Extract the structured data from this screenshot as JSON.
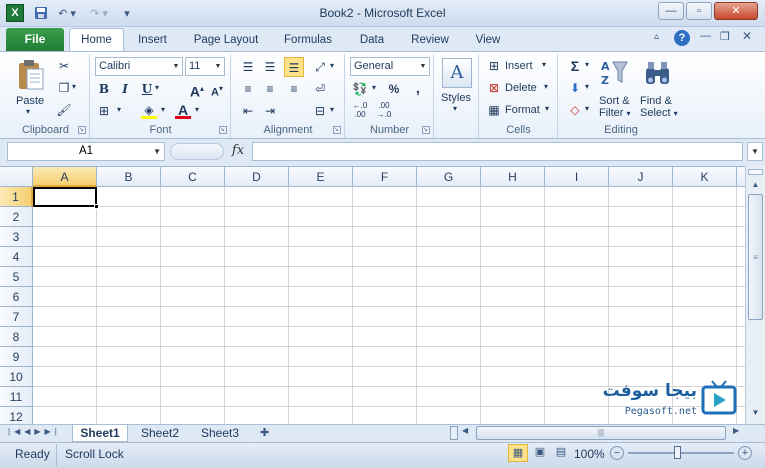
{
  "window": {
    "title": "Book2  -  Microsoft Excel",
    "app_icon": "X",
    "colors": {
      "file_tab": "#2a8c3f",
      "accent": "#1e395b",
      "active_cell_border": "#000000"
    }
  },
  "tabs": [
    "File",
    "Home",
    "Insert",
    "Page Layout",
    "Formulas",
    "Data",
    "Review",
    "View"
  ],
  "ribbon": {
    "clipboard": {
      "label": "Clipboard",
      "paste": "Paste"
    },
    "font": {
      "label": "Font",
      "font_name": "Calibri",
      "font_size": "11",
      "bold": "B",
      "italic": "I",
      "underline": "U"
    },
    "alignment": {
      "label": "Alignment"
    },
    "number": {
      "label": "Number",
      "format": "General",
      "percent": "%",
      "comma": ","
    },
    "styles": {
      "label": "Styles"
    },
    "cells": {
      "label": "Cells",
      "insert": "Insert",
      "delete": "Delete",
      "format": "Format"
    },
    "editing": {
      "label": "Editing",
      "sort_line1": "Sort &",
      "sort_line2": "Filter",
      "find_line1": "Find &",
      "find_line2": "Select"
    }
  },
  "formula_bar": {
    "name_box": "A1",
    "fx": "fx",
    "value": ""
  },
  "grid": {
    "columns": [
      "A",
      "B",
      "C",
      "D",
      "E",
      "F",
      "G",
      "H",
      "I",
      "J",
      "K"
    ],
    "rows": [
      "1",
      "2",
      "3",
      "4",
      "5",
      "6",
      "7",
      "8",
      "9",
      "10",
      "11",
      "12"
    ],
    "active_cell": "A1"
  },
  "sheets": [
    "Sheet1",
    "Sheet2",
    "Sheet3"
  ],
  "active_sheet": "Sheet1",
  "status": {
    "ready": "Ready",
    "scroll_lock": "Scroll Lock",
    "zoom": "100%"
  },
  "watermark": {
    "name": "بيجا سوفت",
    "site": "Pegasoft.net"
  }
}
